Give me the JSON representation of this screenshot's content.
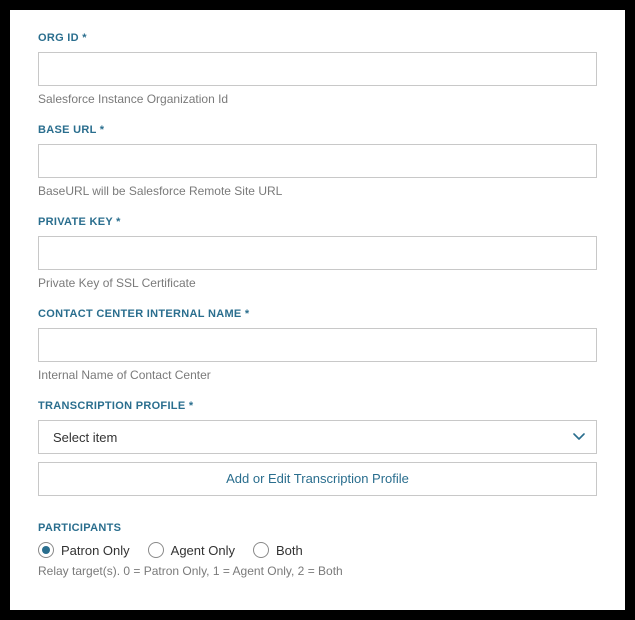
{
  "fields": {
    "org_id": {
      "label": "ORG ID *",
      "value": "",
      "help": "Salesforce Instance Organization Id"
    },
    "base_url": {
      "label": "BASE URL *",
      "value": "",
      "help": "BaseURL will be Salesforce Remote Site URL"
    },
    "private_key": {
      "label": "PRIVATE KEY *",
      "value": "",
      "help": "Private Key of SSL Certificate"
    },
    "contact_center": {
      "label": "CONTACT CENTER INTERNAL NAME *",
      "value": "",
      "help": "Internal Name of Contact Center"
    },
    "transcription_profile": {
      "label": "TRANSCRIPTION PROFILE *",
      "placeholder": "Select item",
      "button": "Add or Edit Transcription Profile"
    },
    "participants": {
      "label": "PARTICIPANTS",
      "options": [
        "Patron Only",
        "Agent Only",
        "Both"
      ],
      "selected_index": 0,
      "help": "Relay target(s). 0 = Patron Only, 1 = Agent Only, 2 = Both"
    }
  }
}
